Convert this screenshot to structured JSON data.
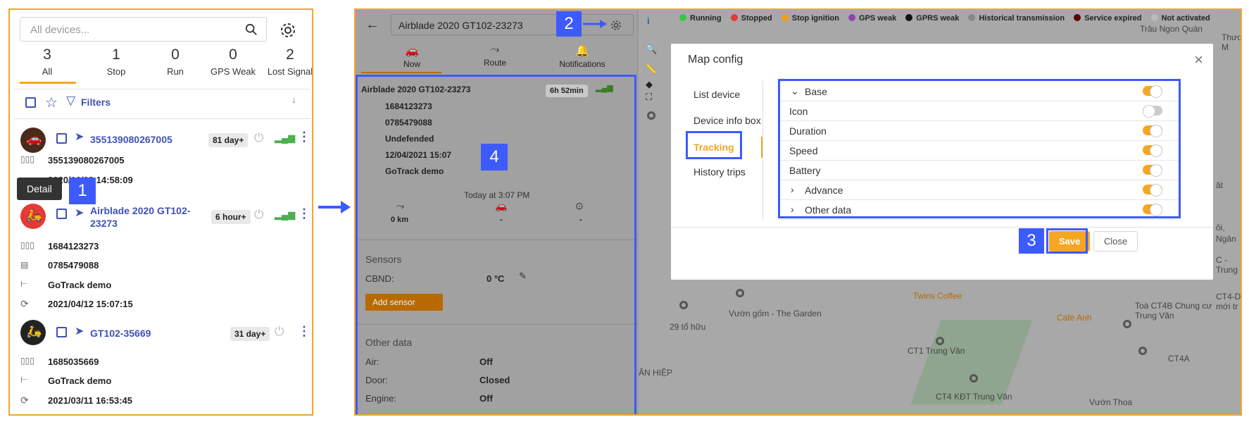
{
  "left": {
    "search_placeholder": "All devices...",
    "stats": [
      {
        "n": "3",
        "l": "All"
      },
      {
        "n": "1",
        "l": "Stop"
      },
      {
        "n": "0",
        "l": "Run"
      },
      {
        "n": "0",
        "l": "GPS Weak"
      },
      {
        "n": "2",
        "l": "Lost Signal"
      }
    ],
    "filters_label": "Filters",
    "tooltip": "Detail",
    "devices": [
      {
        "name": "355139080267005",
        "badge": "81 day+",
        "imei": "355139080267005",
        "time": "2020/10/03 14:58:09"
      },
      {
        "name": "Airblade 2020 GT102-",
        "name2": "23273",
        "badge": "6 hour+",
        "imei": "1684123273",
        "sim": "0785479088",
        "group": "GoTrack demo",
        "time": "2021/04/12 15:07:15"
      },
      {
        "name": "GT102-35669",
        "badge": "31 day+",
        "imei": "1685035669",
        "group": "GoTrack demo",
        "time": "2021/03/11 16:53:45"
      }
    ]
  },
  "steps": [
    "1",
    "2",
    "3",
    "4"
  ],
  "mid": {
    "device_title": "Airblade 2020 GT102-23273",
    "tabs": [
      "Now",
      "Route",
      "Notifications"
    ],
    "info_name": "Airblade 2020 GT102-23273",
    "info_badge": "6h 52min",
    "info_rows": [
      "1684123273",
      "0785479088",
      "Undefended",
      "12/04/2021 15:07",
      "GoTrack demo"
    ],
    "today": "Today at 3:07 PM",
    "km": "0 km",
    "dash1": "-",
    "dash2": "-",
    "sensors_title": "Sensors",
    "sensor_name": "CBND:",
    "sensor_val": "0 °C",
    "add_sensor": "Add sensor",
    "other_title": "Other data",
    "other": [
      {
        "k": "Air:",
        "v": "Off"
      },
      {
        "k": "Door:",
        "v": "Closed"
      },
      {
        "k": "Engine:",
        "v": "Off"
      }
    ]
  },
  "legend": [
    {
      "label": "Running",
      "color": "#2ecc40"
    },
    {
      "label": "Stopped",
      "color": "#e53935"
    },
    {
      "label": "Stop ignition",
      "color": "#f39c12"
    },
    {
      "label": "GPS weak",
      "color": "#8e44ad"
    },
    {
      "label": "GPRS weak",
      "color": "#111111"
    },
    {
      "label": "Historical transmission",
      "color": "#888888"
    },
    {
      "label": "Service expired",
      "color": "#5a0000"
    },
    {
      "label": "Not activated",
      "color": "#bbbbbb"
    }
  ],
  "modal": {
    "title": "Map config",
    "side": [
      "List device",
      "Device info box",
      "Tracking",
      "History trips"
    ],
    "rows": [
      {
        "label": "Base",
        "on": true,
        "chev": "down"
      },
      {
        "label": "Icon",
        "on": false
      },
      {
        "label": "Duration",
        "on": true
      },
      {
        "label": "Speed",
        "on": true
      },
      {
        "label": "Battery",
        "on": true
      },
      {
        "label": "Advance",
        "on": true,
        "chev": "right"
      },
      {
        "label": "Other data",
        "on": true,
        "chev": "right"
      }
    ],
    "save": "Save",
    "close": "Close"
  },
  "map_names": [
    "Trâu Ngon Quán",
    "Thương M",
    "Twins Coffee",
    "Café Anh",
    "Vườn gốm - The Garden",
    "29 tổ hữu",
    "CT1 Trung Văn",
    "ÂN HIỆP",
    "CT4 KĐT Trung Văn",
    "Vườn Thoa",
    "Toà CT4B Chung cư Trung Văn",
    "CT4A",
    "CT4-D mới tr",
    "C - Trung",
    "Ngân",
    "ôi,",
    "ăt"
  ]
}
